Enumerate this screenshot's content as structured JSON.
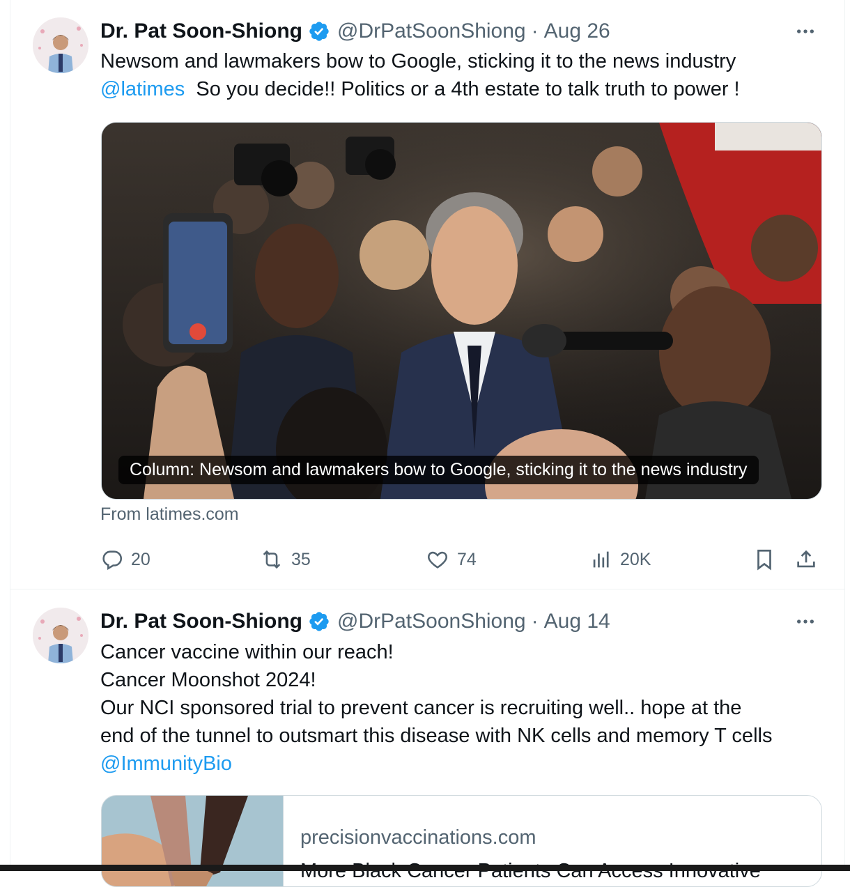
{
  "tweets": [
    {
      "author": {
        "name": "Dr. Pat Soon-Shiong",
        "handle": "@DrPatSoonShiong",
        "verified": true
      },
      "separator": "·",
      "date": "Aug 26",
      "text": {
        "line1": "Newsom and lawmakers bow to Google, sticking it to the news industry",
        "mention": "@latimes",
        "line2_rest": "So you decide!! Politics or a 4th estate to talk truth to power !"
      },
      "media": {
        "caption": "Column: Newsom and lawmakers bow to Google, sticking it to the news industry",
        "source": "From latimes.com"
      },
      "actions": {
        "replies": "20",
        "reposts": "35",
        "likes": "74",
        "views": "20K"
      }
    },
    {
      "author": {
        "name": "Dr. Pat Soon-Shiong",
        "handle": "@DrPatSoonShiong",
        "verified": true
      },
      "separator": "·",
      "date": "Aug 14",
      "text": {
        "line1": "Cancer vaccine within our reach!",
        "line2": "Cancer Moonshot 2024!",
        "line3": "Our NCI sponsored trial to prevent cancer is recruiting well.. hope at the",
        "line4": "end of the tunnel to outsmart this disease with NK cells and memory T cells",
        "mention": "@ImmunityBio"
      },
      "card": {
        "domain": "precisionvaccinations.com",
        "title": "More Black Cancer Patients Can Access Innovative"
      }
    }
  ],
  "icons": {
    "verified": "verified-badge-icon",
    "more": "more-options-icon",
    "reply": "reply-icon",
    "repost": "repost-icon",
    "like": "like-icon",
    "views": "views-icon",
    "bookmark": "bookmark-icon",
    "share": "share-icon"
  },
  "colors": {
    "accent": "#1d9bf0",
    "text": "#0f1419",
    "secondary": "#536471",
    "border": "#cfd9de"
  }
}
